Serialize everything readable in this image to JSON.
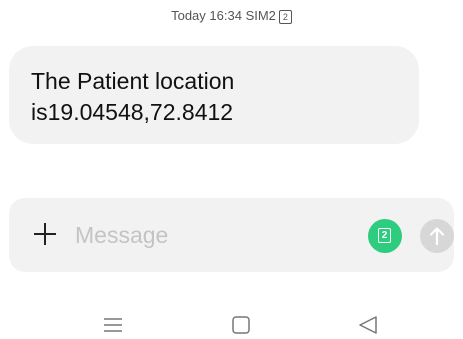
{
  "header": {
    "time": "Today 16:34",
    "sim_label": "SIM2",
    "sim_number": "2"
  },
  "message": {
    "line1": "The Patient location",
    "line2": "is19.04548,72.8412"
  },
  "composer": {
    "placeholder": "Message",
    "sim_number": "2",
    "icons": {
      "attach": "plus-icon",
      "sim": "sim2-icon",
      "send": "arrow-up-icon"
    }
  },
  "navbar": {
    "icons": [
      "menu-icon",
      "home-icon",
      "back-icon"
    ]
  },
  "colors": {
    "bubble": "#f2f2f2",
    "sim_button": "#2ecc7e",
    "send_button_disabled": "#d7d7d7",
    "placeholder": "#c4c4c4"
  }
}
